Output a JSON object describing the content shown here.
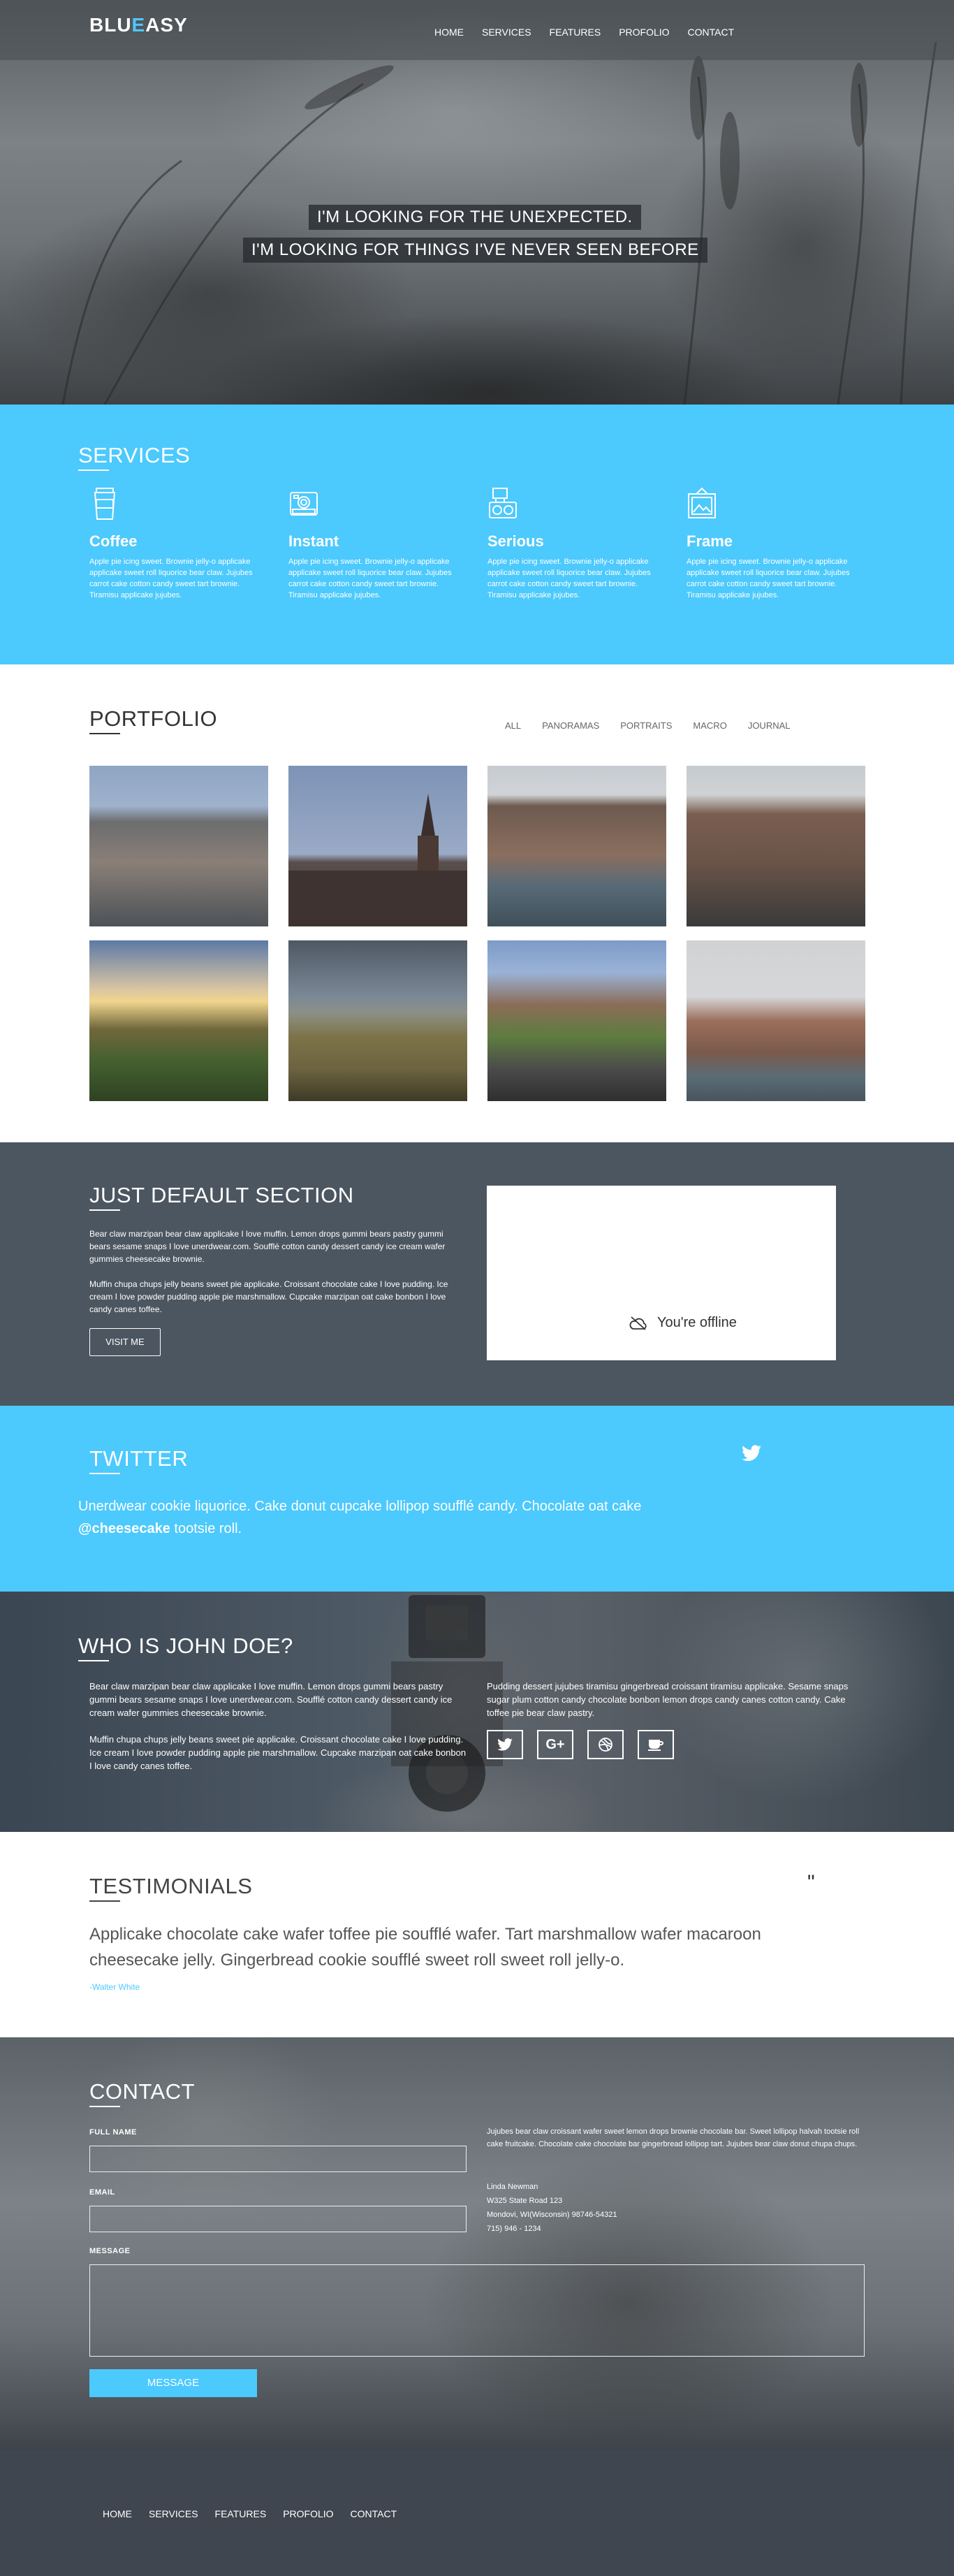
{
  "header": {
    "logo_part1": "BLU",
    "logo_part2": "E",
    "logo_part3": "ASY",
    "nav": [
      "HOME",
      "SERVICES",
      "FEATURES",
      "PROFOLIO",
      "CONTACT"
    ],
    "tagline1": "I'M LOOKING FOR THE UNEXPECTED.",
    "tagline2": "I'M LOOKING FOR THINGS I'VE NEVER SEEN BEFORE"
  },
  "services": {
    "title": "SERVICES",
    "items": [
      {
        "icon": "coffee-cup-icon",
        "title": "Coffee",
        "text": "Apple pie icing sweet. Brownie jelly-o applicake applicake sweet roll liquorice bear claw. Jujubes carrot cake cotton candy sweet tart brownie. Tiramisu applicake jujubes."
      },
      {
        "icon": "camera-instant-icon",
        "title": "Instant",
        "text": "Apple pie icing sweet. Brownie jelly-o applicake applicake sweet roll liquorice bear claw. Jujubes carrot cake cotton candy sweet tart brownie. Tiramisu applicake jujubes."
      },
      {
        "icon": "film-camera-icon",
        "title": "Serious",
        "text": "Apple pie icing sweet. Brownie jelly-o applicake applicake sweet roll liquorice bear claw. Jujubes carrot cake cotton candy sweet tart brownie. Tiramisu applicake jujubes."
      },
      {
        "icon": "picture-frame-icon",
        "title": "Frame",
        "text": "Apple pie icing sweet. Brownie jelly-o applicake applicake sweet roll liquorice bear claw. Jujubes carrot cake cotton candy sweet tart brownie. Tiramisu applicake jujubes."
      }
    ]
  },
  "portfolio": {
    "title": "PORTFOLIO",
    "filters": [
      "ALL",
      "PANORAMAS",
      "PORTRAITS",
      "MACRO",
      "JOURNAL"
    ]
  },
  "default_section": {
    "title": "JUST DEFAULT SECTION",
    "p1": "Bear claw marzipan bear claw applicake I love muffin. Lemon drops gummi bears pastry gummi bears sesame snaps I love unerdwear.com. Soufflé cotton candy dessert candy ice cream wafer gummies cheesecake brownie.",
    "p2": "Muffin chupa chups jelly beans sweet pie applicake. Croissant chocolate cake I love pudding. Ice cream I love powder pudding apple pie marshmallow. Cupcake marzipan oat cake bonbon I love candy canes toffee.",
    "button": "VISIT ME",
    "offline": "You're offline"
  },
  "twitter": {
    "title": "TWITTER",
    "tweet": "Unerdwear cookie liquorice. Cake donut cupcake lollipop soufflé candy. Chocolate oat cake ",
    "handle": "@cheesecake",
    "tweet_end": " tootsie roll."
  },
  "who": {
    "title": "WHO IS JOHN DOE?",
    "p1": "Bear claw marzipan bear claw applicake I love muffin. Lemon drops gummi bears pastry gummi bears sesame snaps I love unerdwear.com. Soufflé cotton candy dessert candy ice cream wafer gummies cheesecake brownie.",
    "p2": "Muffin chupa chups jelly beans sweet pie applicake. Croissant chocolate cake I love pudding. Ice cream I love powder pudding apple pie marshmallow. Cupcake marzipan oat cake bonbon I love candy canes toffee.",
    "p3": "Pudding dessert jujubes tiramisu gingerbread croissant tiramisu applicake. Sesame snaps sugar plum cotton candy chocolate bonbon lemon drops candy canes cotton candy. Cake toffee pie bear claw pastry.",
    "social": [
      "twitter-icon",
      "google-plus-icon",
      "dribbble-icon",
      "coffee-icon"
    ],
    "gplus": "G+"
  },
  "testimonials": {
    "title": "TESTIMONIALS",
    "quote": "\"",
    "text": "Applicake chocolate cake wafer toffee pie soufflé wafer. Tart marshmallow wafer macaroon cheesecake jelly. Gingerbread cookie soufflé sweet roll sweet roll jelly-o.",
    "author": "-Walter White"
  },
  "contact": {
    "title": "CONTACT",
    "name_label": "FULL NAME",
    "email_label": "EMAIL",
    "message_label": "MESSAGE",
    "button": "MESSAGE",
    "info": "Jujubes bear claw croissant wafer sweet lemon drops brownie chocolate bar. Sweet lollipop halvah tootsie roll cake fruitcake. Chocolate cake chocolate bar gingerbread lollipop tart. Jujubes bear claw donut chupa chups.",
    "addr": [
      "Linda Newman",
      "W325 State Road 123",
      "Mondovi, WI(Wisconsin) 98746-54321",
      "715) 946 - 1234"
    ]
  },
  "footer": {
    "nav": [
      "HOME",
      "SERVICES",
      "FEATURES",
      "PROFOLIO",
      "CONTACT"
    ]
  },
  "colors": {
    "accent": "#4cc9fd",
    "dark": "#4c5660",
    "footer": "#3f464f"
  }
}
